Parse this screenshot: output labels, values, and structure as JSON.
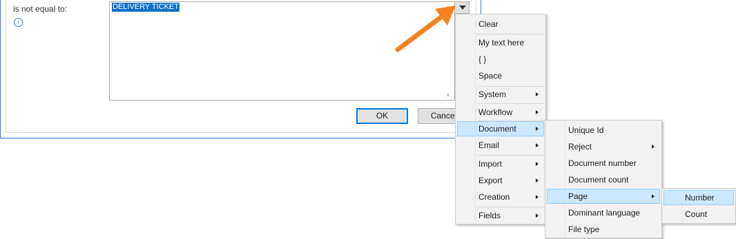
{
  "dialog": {
    "condition_label": "is not equal to:",
    "info_icon": "info-icon",
    "text_value": "DELIVERY TICKET",
    "ok_label": "OK",
    "cancel_label": "Cancel"
  },
  "accent_color": "#f58220",
  "menu1": {
    "items": [
      {
        "label": "Clear"
      },
      {
        "label": "My text here"
      },
      {
        "label": "{ }"
      },
      {
        "label": "Space"
      },
      {
        "label": "System"
      },
      {
        "label": "Workflow"
      },
      {
        "label": "Document"
      },
      {
        "label": "Email"
      },
      {
        "label": "Import"
      },
      {
        "label": "Export"
      },
      {
        "label": "Creation"
      },
      {
        "label": "Fields"
      }
    ]
  },
  "menu2": {
    "items": [
      {
        "label": "Unique Id"
      },
      {
        "label": "Reject"
      },
      {
        "label": "Document number"
      },
      {
        "label": "Document count"
      },
      {
        "label": "Page"
      },
      {
        "label": "Dominant language"
      },
      {
        "label": "File type"
      }
    ]
  },
  "menu3": {
    "items": [
      {
        "label": "Number"
      },
      {
        "label": "Count"
      }
    ]
  }
}
